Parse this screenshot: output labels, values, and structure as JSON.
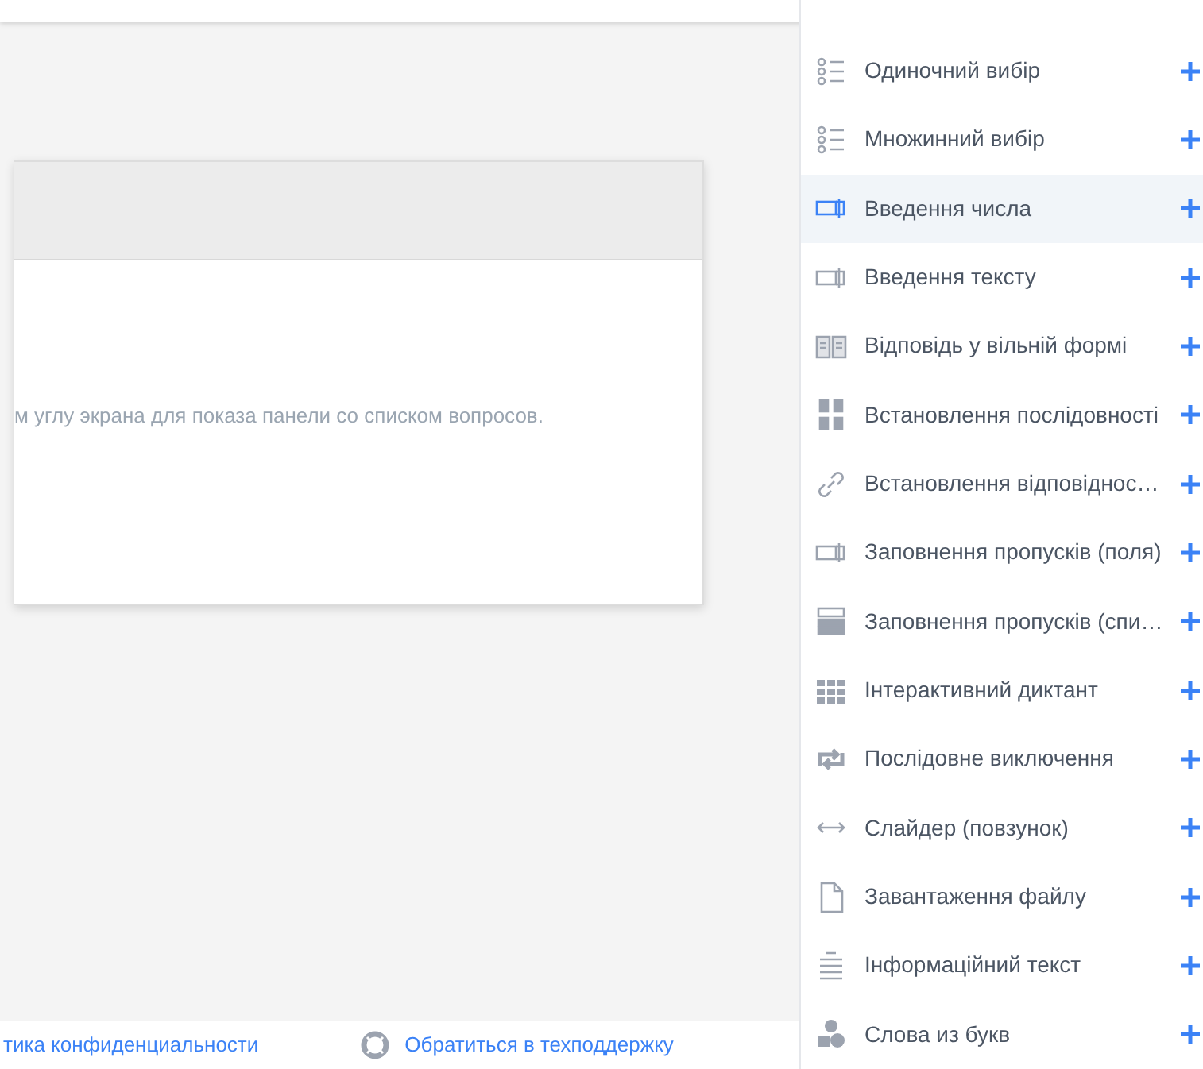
{
  "card": {
    "message": "м углу экрана для показа панели со списком вопросов."
  },
  "question_types": [
    {
      "label": "Одиночний вибір",
      "kind": "list",
      "selected": false
    },
    {
      "label": "Множинний вибір",
      "kind": "list",
      "selected": false
    },
    {
      "label": "Введення числа",
      "kind": "input",
      "selected": true
    },
    {
      "label": "Введення тексту",
      "kind": "input",
      "selected": false
    },
    {
      "label": "Відповідь у вільній формі",
      "kind": "book",
      "selected": false
    },
    {
      "label": "Встановлення послідовності",
      "kind": "sequence",
      "selected": false
    },
    {
      "label": "Встановлення відповіднос…",
      "kind": "link",
      "selected": false
    },
    {
      "label": "Заповнення пропусків (поля)",
      "kind": "input",
      "selected": false
    },
    {
      "label": "Заповнення пропусків (спи…",
      "kind": "dropdown",
      "selected": false
    },
    {
      "label": "Інтерактивний диктант",
      "kind": "grid",
      "selected": false
    },
    {
      "label": "Послідовне виключення",
      "kind": "repeat",
      "selected": false
    },
    {
      "label": "Слайдер (повзунок)",
      "kind": "arrows",
      "selected": false
    },
    {
      "label": "Завантаження файлу",
      "kind": "file",
      "selected": false
    },
    {
      "label": "Інформаційний текст",
      "kind": "text",
      "selected": false
    },
    {
      "label": "Слова из букв",
      "kind": "letters",
      "selected": false
    }
  ],
  "footer": {
    "privacy_link": "тика конфиденциальности",
    "support_link": "Обратиться в техподдержку"
  }
}
